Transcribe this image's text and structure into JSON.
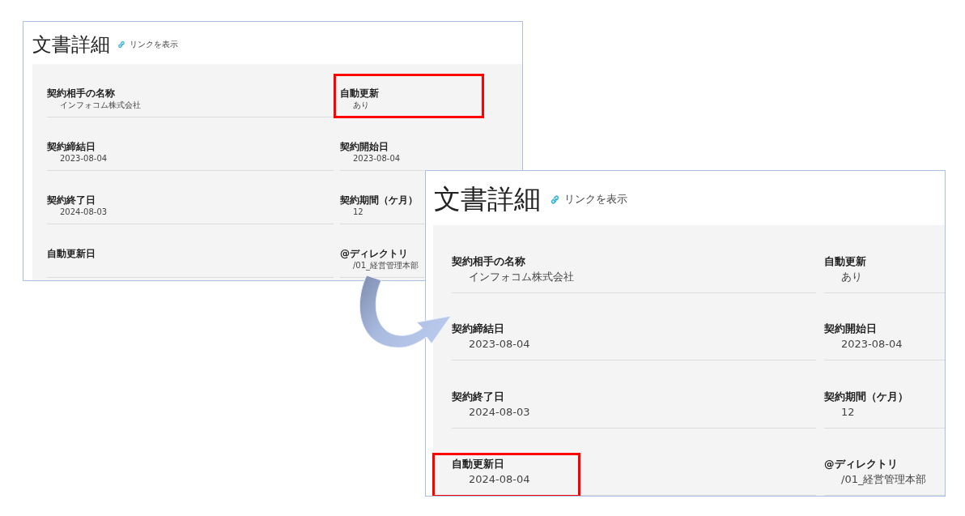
{
  "panels": [
    {
      "title": "文書詳細",
      "link": "リンクを表示",
      "fields": [
        {
          "label": "契約相手の名称",
          "value": "インフォコム株式会社",
          "highlighted": false
        },
        {
          "label": "自動更新",
          "value": "あり",
          "highlighted": true
        },
        {
          "label": "契約締結日",
          "value": "2023-08-04",
          "highlighted": false
        },
        {
          "label": "契約開始日",
          "value": "2023-08-04",
          "highlighted": false
        },
        {
          "label": "契約終了日",
          "value": "2024-08-03",
          "highlighted": false
        },
        {
          "label": "契約期間（ケ月）",
          "value": "12",
          "highlighted": false
        },
        {
          "label": "自動更新日",
          "highlighted": false
        },
        {
          "label": "@ディレクトリ",
          "value": "/01_経営管理本部",
          "highlighted": false
        }
      ]
    },
    {
      "title": "文書詳細",
      "link": "リンクを表示",
      "fields": [
        {
          "label": "契約相手の名称",
          "value": "インフォコム株式会社",
          "highlighted": false
        },
        {
          "label": "自動更新",
          "value": "あり",
          "highlighted": false
        },
        {
          "label": "契約締結日",
          "value": "2023-08-04",
          "highlighted": false
        },
        {
          "label": "契約開始日",
          "value": "2023-08-04",
          "highlighted": false
        },
        {
          "label": "契約終了日",
          "value": "2024-08-03",
          "highlighted": false
        },
        {
          "label": "契約期間（ケ月）",
          "value": "12",
          "highlighted": false
        },
        {
          "label": "自動更新日",
          "value": "2024-08-04",
          "highlighted": true
        },
        {
          "label": "@ディレクトリ",
          "value": "/01_経営管理本部",
          "highlighted": false
        }
      ]
    }
  ]
}
